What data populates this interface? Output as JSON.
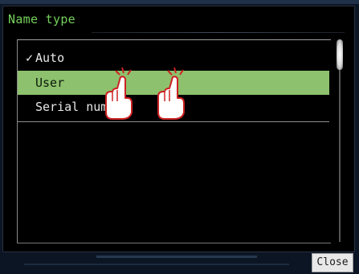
{
  "dialog": {
    "title": "Name type",
    "options": [
      {
        "label": "Auto",
        "checked": true,
        "selected": false
      },
      {
        "label": "User",
        "checked": false,
        "selected": true
      },
      {
        "label": "Serial number",
        "checked": false,
        "selected": false
      }
    ],
    "checkmark": "✓",
    "close_label": "Close"
  },
  "overlay": {
    "icons": [
      "tap-hand-icon",
      "tap-hand-icon"
    ]
  },
  "colors": {
    "title": "#74d05c",
    "selected_row": "#8dc16d",
    "screen_bg": "#000000",
    "outer_bg": "#0c1524"
  }
}
